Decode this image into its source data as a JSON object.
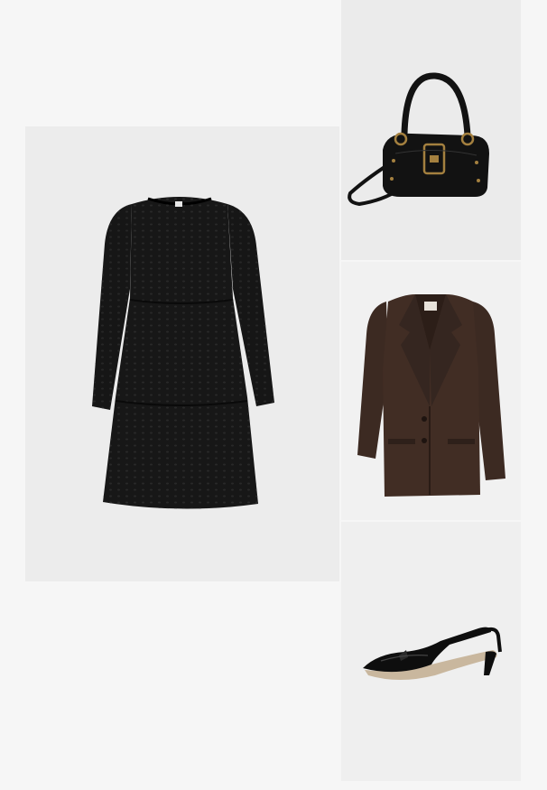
{
  "products": [
    {
      "id": "dress",
      "icon": "black-eyelet-tiered-dress-image"
    },
    {
      "id": "bag",
      "icon": "black-leather-buckle-handbag-image"
    },
    {
      "id": "blazer",
      "icon": "dark-brown-oversized-blazer-image"
    },
    {
      "id": "shoes",
      "icon": "black-patent-slingback-pumps-image"
    }
  ],
  "colors": {
    "page_background": "#f6f6f6",
    "dress": "#161616",
    "bag": "#121212",
    "hardware": "#a4803f",
    "blazer": "#3c2a22",
    "shoes": "#0e0e0e"
  }
}
